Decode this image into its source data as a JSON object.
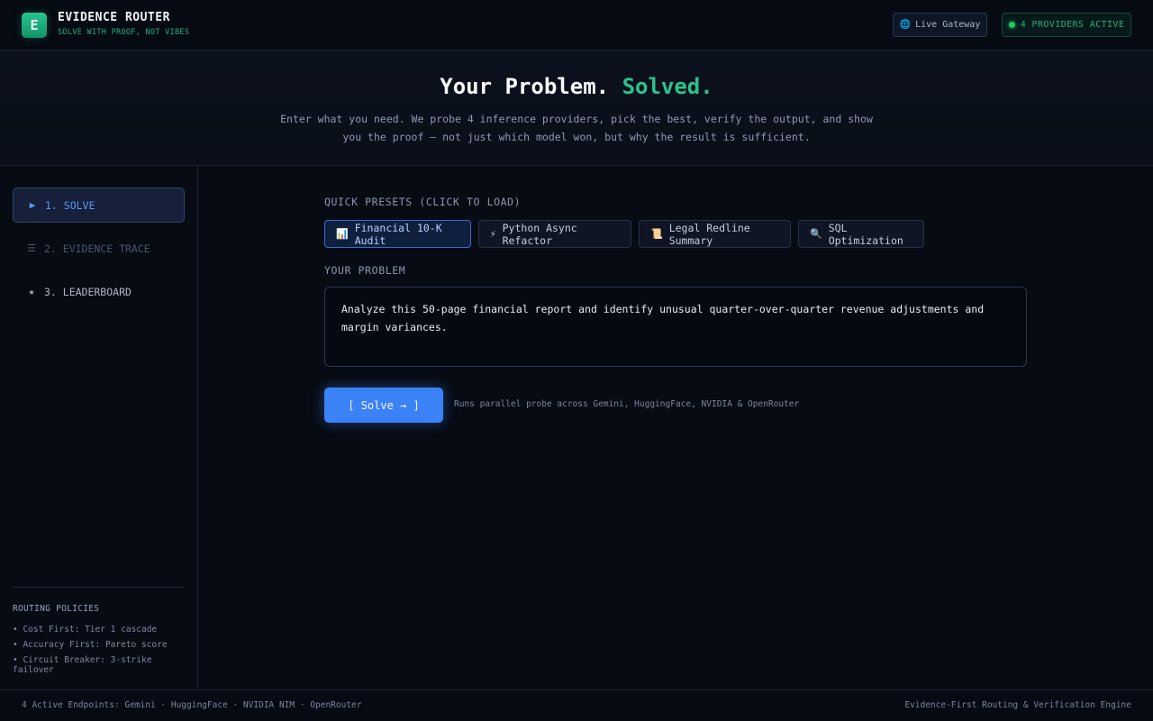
{
  "header": {
    "logo_letter": "E",
    "title": "EVIDENCE ROUTER",
    "subtitle": "SOLVE WITH PROOF, NOT VIBES",
    "gateway_label": "Live Gateway",
    "gateway_icon": "globe-icon",
    "providers_label": "4 PROVIDERS ACTIVE"
  },
  "hero": {
    "title_main": "Your Problem.",
    "title_accent": "Solved.",
    "description": "Enter what you need. We probe 4 inference providers, pick the best, verify the output, and show you the proof — not just which model won, but why the result is sufficient."
  },
  "sidebar": {
    "items": [
      {
        "label": "1. SOLVE",
        "icon": "play-icon",
        "active": true
      },
      {
        "label": "2. EVIDENCE TRACE",
        "icon": "list-icon",
        "active": false
      },
      {
        "label": "3. LEADERBOARD",
        "icon": "star-icon",
        "active": false
      }
    ],
    "policies_title": "ROUTING POLICIES",
    "policies": [
      "• Cost First: Tier 1 cascade",
      "• Accuracy First: Pareto score",
      "• Circuit Breaker: 3-strike failover"
    ]
  },
  "main": {
    "presets_label": "QUICK PRESETS (CLICK TO LOAD)",
    "presets": [
      {
        "label": "Financial 10-K Audit",
        "icon": "chart-icon",
        "glyph": "📊",
        "selected": true
      },
      {
        "label": "Python Async Refactor",
        "icon": "lightning-icon",
        "glyph": "⚡",
        "selected": false
      },
      {
        "label": "Legal Redline Summary",
        "icon": "scroll-icon",
        "glyph": "📜",
        "selected": false
      },
      {
        "label": "SQL Optimization",
        "icon": "magnifier-icon",
        "glyph": "🔍",
        "selected": false
      }
    ],
    "problem_label": "YOUR PROBLEM",
    "problem_text": "Analyze this 50-page financial report and identify unusual quarter-over-quarter revenue adjustments and margin variances.",
    "solve_button": "[ Solve → ]",
    "solve_hint": "Runs parallel probe across Gemini, HuggingFace, NVIDIA & OpenRouter"
  },
  "footer": {
    "left": "4 Active Endpoints: Gemini · HuggingFace · NVIDIA NIM · OpenRouter",
    "right": "Evidence-First Routing & Verification Engine"
  },
  "colors": {
    "accent_green": "#2ac28c",
    "accent_blue": "#3b82f6",
    "background": "#070b14"
  }
}
